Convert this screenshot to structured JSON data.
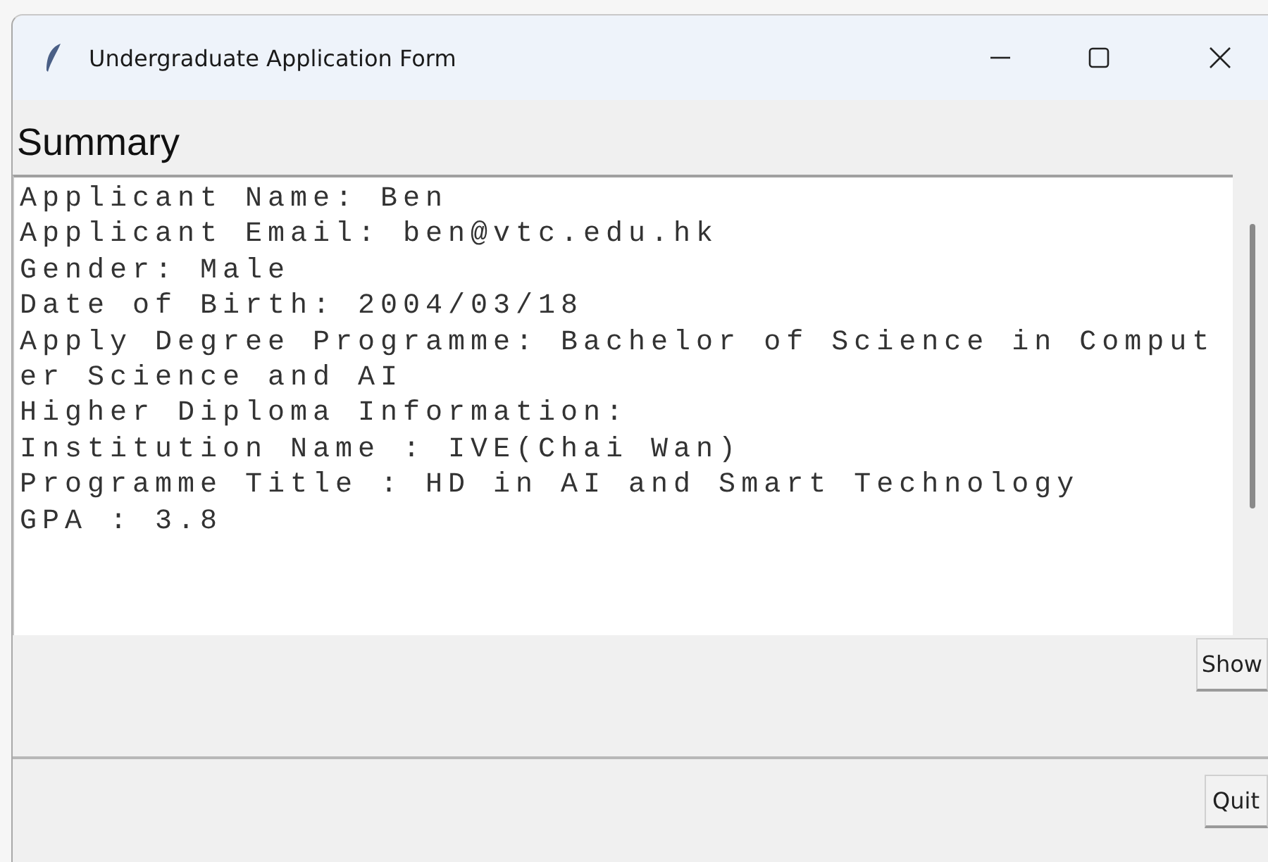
{
  "window": {
    "title": "Undergraduate Application Form"
  },
  "heading": "Summary",
  "summary_lines": [
    "Applicant Name: Ben",
    "Applicant Email: ben@vtc.edu.hk",
    "Gender: Male",
    "Date of Birth: 2004/03/18",
    "Apply Degree Programme: Bachelor of Science in Comput",
    "er Science and AI",
    "Higher Diploma Information:",
    "Institution Name : IVE(Chai Wan)",
    "Programme Title : HD in AI and Smart Technology",
    "GPA : 3.8"
  ],
  "buttons": [
    {
      "label": "Show"
    },
    {
      "label": "Quit"
    }
  ]
}
